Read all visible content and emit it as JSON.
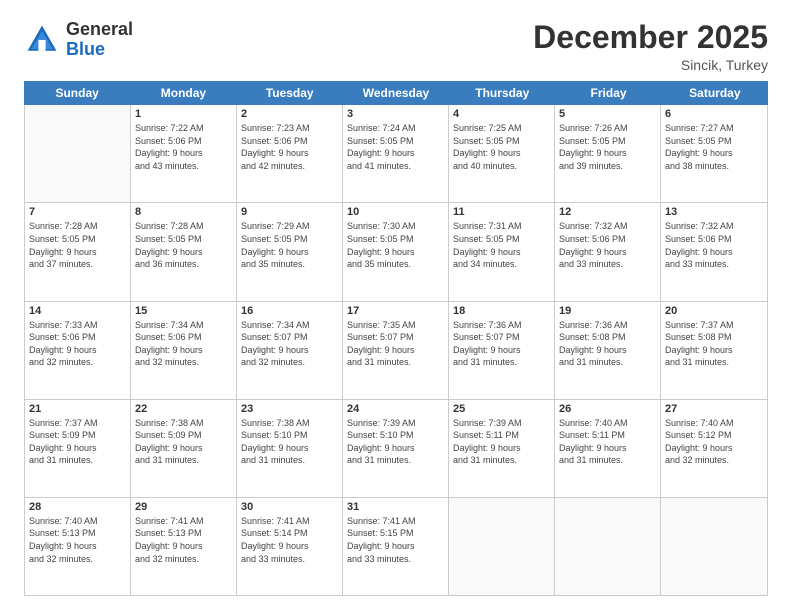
{
  "header": {
    "logo_general": "General",
    "logo_blue": "Blue",
    "month": "December 2025",
    "location": "Sincik, Turkey"
  },
  "weekdays": [
    "Sunday",
    "Monday",
    "Tuesday",
    "Wednesday",
    "Thursday",
    "Friday",
    "Saturday"
  ],
  "weeks": [
    [
      {
        "day": "",
        "info": ""
      },
      {
        "day": "1",
        "info": "Sunrise: 7:22 AM\nSunset: 5:06 PM\nDaylight: 9 hours\nand 43 minutes."
      },
      {
        "day": "2",
        "info": "Sunrise: 7:23 AM\nSunset: 5:06 PM\nDaylight: 9 hours\nand 42 minutes."
      },
      {
        "day": "3",
        "info": "Sunrise: 7:24 AM\nSunset: 5:05 PM\nDaylight: 9 hours\nand 41 minutes."
      },
      {
        "day": "4",
        "info": "Sunrise: 7:25 AM\nSunset: 5:05 PM\nDaylight: 9 hours\nand 40 minutes."
      },
      {
        "day": "5",
        "info": "Sunrise: 7:26 AM\nSunset: 5:05 PM\nDaylight: 9 hours\nand 39 minutes."
      },
      {
        "day": "6",
        "info": "Sunrise: 7:27 AM\nSunset: 5:05 PM\nDaylight: 9 hours\nand 38 minutes."
      }
    ],
    [
      {
        "day": "7",
        "info": "Sunrise: 7:28 AM\nSunset: 5:05 PM\nDaylight: 9 hours\nand 37 minutes."
      },
      {
        "day": "8",
        "info": "Sunrise: 7:28 AM\nSunset: 5:05 PM\nDaylight: 9 hours\nand 36 minutes."
      },
      {
        "day": "9",
        "info": "Sunrise: 7:29 AM\nSunset: 5:05 PM\nDaylight: 9 hours\nand 35 minutes."
      },
      {
        "day": "10",
        "info": "Sunrise: 7:30 AM\nSunset: 5:05 PM\nDaylight: 9 hours\nand 35 minutes."
      },
      {
        "day": "11",
        "info": "Sunrise: 7:31 AM\nSunset: 5:05 PM\nDaylight: 9 hours\nand 34 minutes."
      },
      {
        "day": "12",
        "info": "Sunrise: 7:32 AM\nSunset: 5:06 PM\nDaylight: 9 hours\nand 33 minutes."
      },
      {
        "day": "13",
        "info": "Sunrise: 7:32 AM\nSunset: 5:06 PM\nDaylight: 9 hours\nand 33 minutes."
      }
    ],
    [
      {
        "day": "14",
        "info": "Sunrise: 7:33 AM\nSunset: 5:06 PM\nDaylight: 9 hours\nand 32 minutes."
      },
      {
        "day": "15",
        "info": "Sunrise: 7:34 AM\nSunset: 5:06 PM\nDaylight: 9 hours\nand 32 minutes."
      },
      {
        "day": "16",
        "info": "Sunrise: 7:34 AM\nSunset: 5:07 PM\nDaylight: 9 hours\nand 32 minutes."
      },
      {
        "day": "17",
        "info": "Sunrise: 7:35 AM\nSunset: 5:07 PM\nDaylight: 9 hours\nand 31 minutes."
      },
      {
        "day": "18",
        "info": "Sunrise: 7:36 AM\nSunset: 5:07 PM\nDaylight: 9 hours\nand 31 minutes."
      },
      {
        "day": "19",
        "info": "Sunrise: 7:36 AM\nSunset: 5:08 PM\nDaylight: 9 hours\nand 31 minutes."
      },
      {
        "day": "20",
        "info": "Sunrise: 7:37 AM\nSunset: 5:08 PM\nDaylight: 9 hours\nand 31 minutes."
      }
    ],
    [
      {
        "day": "21",
        "info": "Sunrise: 7:37 AM\nSunset: 5:09 PM\nDaylight: 9 hours\nand 31 minutes."
      },
      {
        "day": "22",
        "info": "Sunrise: 7:38 AM\nSunset: 5:09 PM\nDaylight: 9 hours\nand 31 minutes."
      },
      {
        "day": "23",
        "info": "Sunrise: 7:38 AM\nSunset: 5:10 PM\nDaylight: 9 hours\nand 31 minutes."
      },
      {
        "day": "24",
        "info": "Sunrise: 7:39 AM\nSunset: 5:10 PM\nDaylight: 9 hours\nand 31 minutes."
      },
      {
        "day": "25",
        "info": "Sunrise: 7:39 AM\nSunset: 5:11 PM\nDaylight: 9 hours\nand 31 minutes."
      },
      {
        "day": "26",
        "info": "Sunrise: 7:40 AM\nSunset: 5:11 PM\nDaylight: 9 hours\nand 31 minutes."
      },
      {
        "day": "27",
        "info": "Sunrise: 7:40 AM\nSunset: 5:12 PM\nDaylight: 9 hours\nand 32 minutes."
      }
    ],
    [
      {
        "day": "28",
        "info": "Sunrise: 7:40 AM\nSunset: 5:13 PM\nDaylight: 9 hours\nand 32 minutes."
      },
      {
        "day": "29",
        "info": "Sunrise: 7:41 AM\nSunset: 5:13 PM\nDaylight: 9 hours\nand 32 minutes."
      },
      {
        "day": "30",
        "info": "Sunrise: 7:41 AM\nSunset: 5:14 PM\nDaylight: 9 hours\nand 33 minutes."
      },
      {
        "day": "31",
        "info": "Sunrise: 7:41 AM\nSunset: 5:15 PM\nDaylight: 9 hours\nand 33 minutes."
      },
      {
        "day": "",
        "info": ""
      },
      {
        "day": "",
        "info": ""
      },
      {
        "day": "",
        "info": ""
      }
    ]
  ]
}
